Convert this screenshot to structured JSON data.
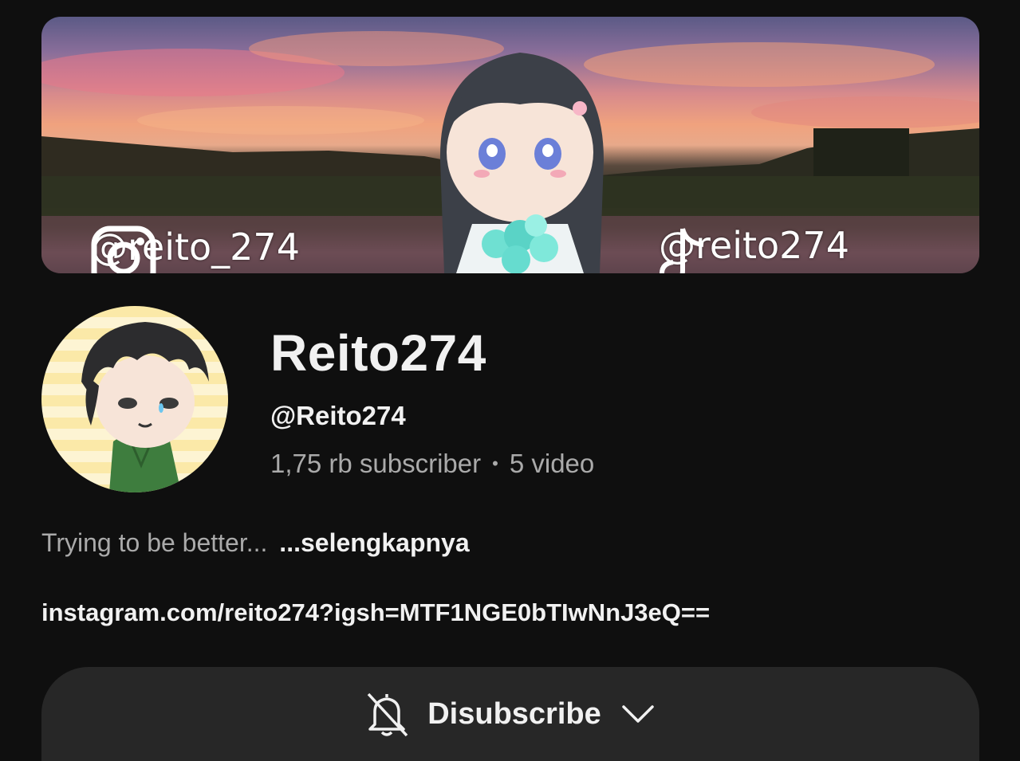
{
  "banner": {
    "instagram_handle": "@reito_274",
    "tiktok_handle": "@reito274"
  },
  "channel": {
    "name": "Reito274",
    "handle": "@Reito274",
    "subscribers": "1,75 rb subscriber",
    "separator": "•",
    "videos": "5 video"
  },
  "description": {
    "text": "Trying to be better...",
    "more_label": "...selengkapnya"
  },
  "link": "instagram.com/reito274?igsh=MTF1NGE0bTIwNnJ3eQ==",
  "subscription": {
    "button_label": "Disubscribe",
    "bell_icon": "bell-off-icon",
    "dropdown_icon": "chevron-down-icon"
  }
}
